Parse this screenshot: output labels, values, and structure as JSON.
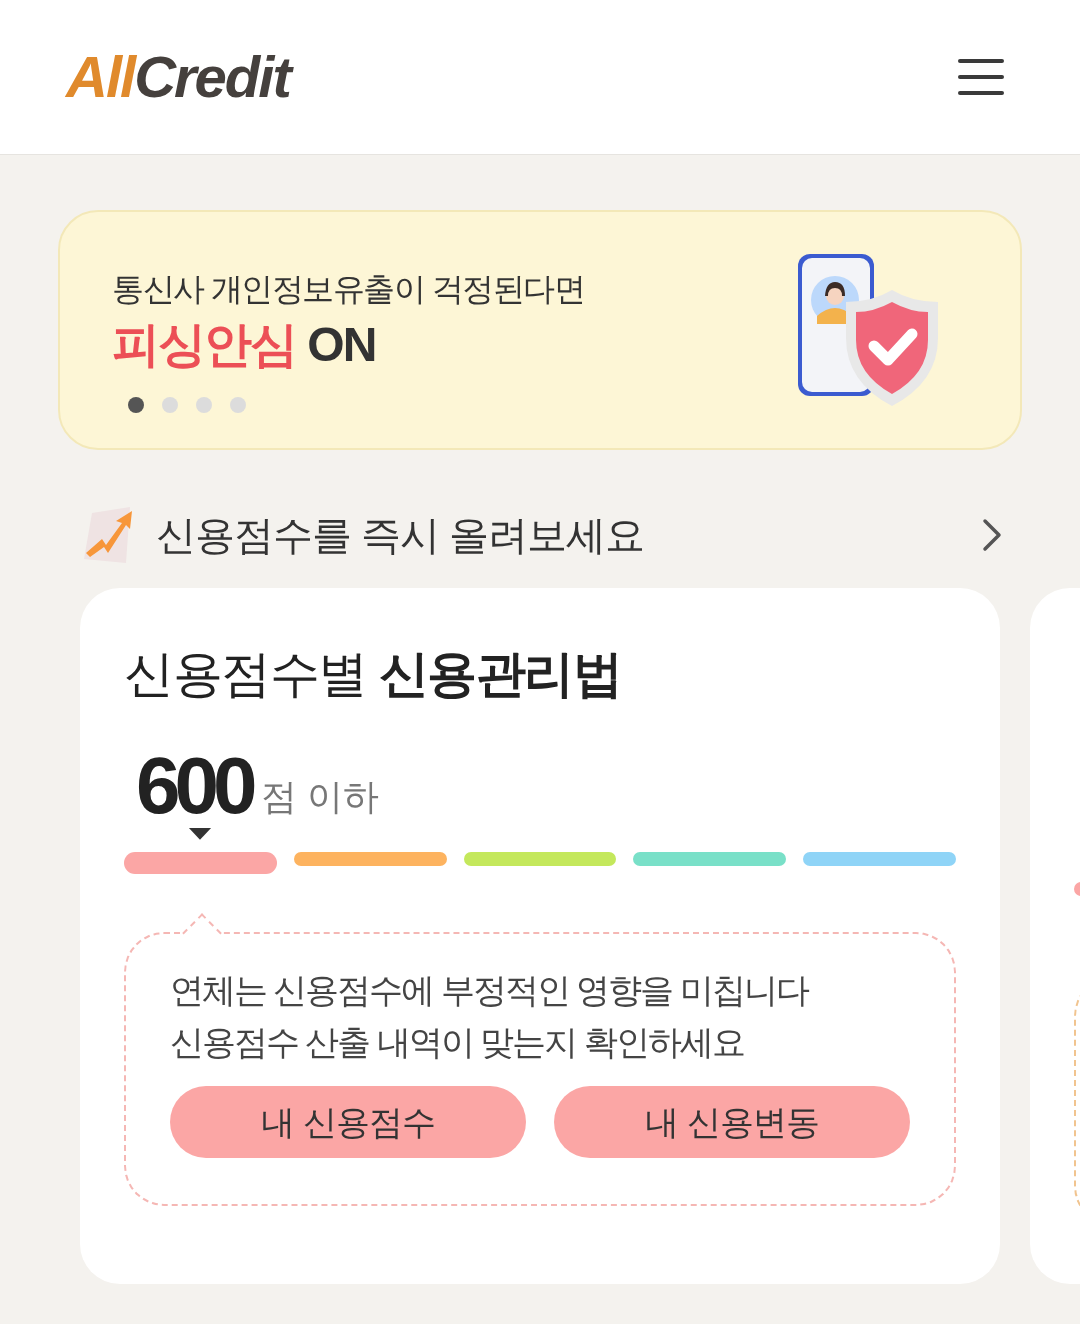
{
  "header": {
    "logo": {
      "accent": "All",
      "rest": "Credit"
    }
  },
  "banner": {
    "subtitle": "통신사 개인정보유출이 걱정된다면",
    "highlight": "피싱안심",
    "title_rest": "ON",
    "dots": [
      {
        "selected": true
      },
      {
        "selected": false
      },
      {
        "selected": false
      },
      {
        "selected": false
      }
    ]
  },
  "promo_link": {
    "text": "신용점수를 즉시 올려보세요"
  },
  "cards": [
    {
      "title_light": "신용점수별",
      "title_bold": "신용관리법",
      "score": "600",
      "score_unit": "점 이하",
      "levels": [
        {
          "color": "#fba6a5",
          "selected": true
        },
        {
          "color": "#fdb35f",
          "selected": false
        },
        {
          "color": "#c4e85c",
          "selected": false
        },
        {
          "color": "#79e0c8",
          "selected": false
        },
        {
          "color": "#8fd4f7",
          "selected": false
        }
      ],
      "notice": [
        "연체는 신용점수에 부정적인 영향을 미칩니다",
        "신용점수 산출 내역이 맞는지 확인하세요"
      ],
      "buttons": [
        "내 신용점수",
        "내 신용변동"
      ]
    }
  ],
  "next_card": {
    "color": "#fba6a5"
  }
}
